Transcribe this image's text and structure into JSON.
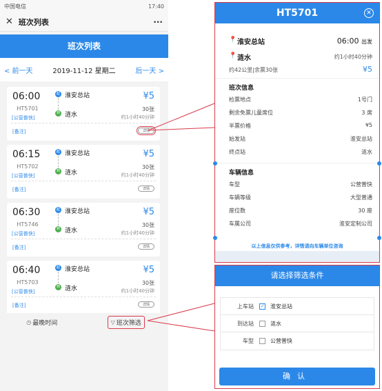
{
  "statusbar": {
    "carrier": "中国电信",
    "time": "17:40"
  },
  "titlebar": {
    "close": "✕",
    "title": "班次列表",
    "more": "···"
  },
  "header": {
    "title": "班次列表"
  },
  "datebar": {
    "prev": "< 前一天",
    "date": "2019-11-12  星期二",
    "next": "后一天 >"
  },
  "cards": [
    {
      "time": "06:00",
      "code": "HT5701",
      "type": "[公营普快]",
      "from": "淮安总站",
      "to": "涟水",
      "price": "¥5",
      "seats": "30张",
      "duration": "约1小时40分钟",
      "note": "[备注]",
      "detail": "详情"
    },
    {
      "time": "06:15",
      "code": "HT5702",
      "type": "[公营普快]",
      "from": "淮安总站",
      "to": "涟水",
      "price": "¥5",
      "seats": "30张",
      "duration": "约1小时40分钟",
      "note": "[备注]",
      "detail": "详情"
    },
    {
      "time": "06:30",
      "code": "HT5746",
      "type": "[公营普快]",
      "from": "淮安总站",
      "to": "涟水",
      "price": "¥5",
      "seats": "30张",
      "duration": "约1小时40分钟",
      "note": "[备注]",
      "detail": "详情"
    },
    {
      "time": "06:40",
      "code": "HT5703",
      "type": "[公营普快]",
      "from": "淮安总站",
      "to": "涟水",
      "price": "¥5",
      "seats": "30张",
      "duration": "约1小时40分钟",
      "note": "[备注]",
      "detail": "详情"
    }
  ],
  "bottombar": {
    "latest": "最晚时间",
    "filter": "班次筛选"
  },
  "detail_panel": {
    "title": "HT5701",
    "from": "淮安总站",
    "to": "涟水",
    "depart": "06:00",
    "depart_suffix": "出发",
    "duration": "约1小时40分钟",
    "distance": "约42公里|余票30张",
    "price": "¥5",
    "section1_title": "班次信息",
    "section1_rows": [
      {
        "k": "检票地点",
        "v": "1号门"
      },
      {
        "k": "剩余免票儿童席位",
        "v": "3 席"
      },
      {
        "k": "半票价格",
        "v": "¥5"
      },
      {
        "k": "始发站",
        "v": "淮安总站"
      },
      {
        "k": "终点站",
        "v": "涟水"
      }
    ],
    "section2_title": "车辆信息",
    "section2_rows": [
      {
        "k": "车型",
        "v": "公营普快"
      },
      {
        "k": "车辆等级",
        "v": "大型普通"
      },
      {
        "k": "座位数",
        "v": "30 座"
      },
      {
        "k": "车属公司",
        "v": "淮安定制公司"
      }
    ],
    "footer": "以上信息仅供参考，详情请向车辆单位咨询"
  },
  "filter_panel": {
    "title": "请选择筛选条件",
    "rows": [
      {
        "label": "上车站",
        "value": "淮安总站",
        "checked": true
      },
      {
        "label": "到达站",
        "value": "涟水",
        "checked": false
      },
      {
        "label": "车型",
        "value": "公营普快",
        "checked": false
      }
    ],
    "confirm": "确认"
  },
  "colors": {
    "accent": "#2b88e8",
    "highlight": "#d9394a",
    "to_station": "#4cae4c"
  }
}
